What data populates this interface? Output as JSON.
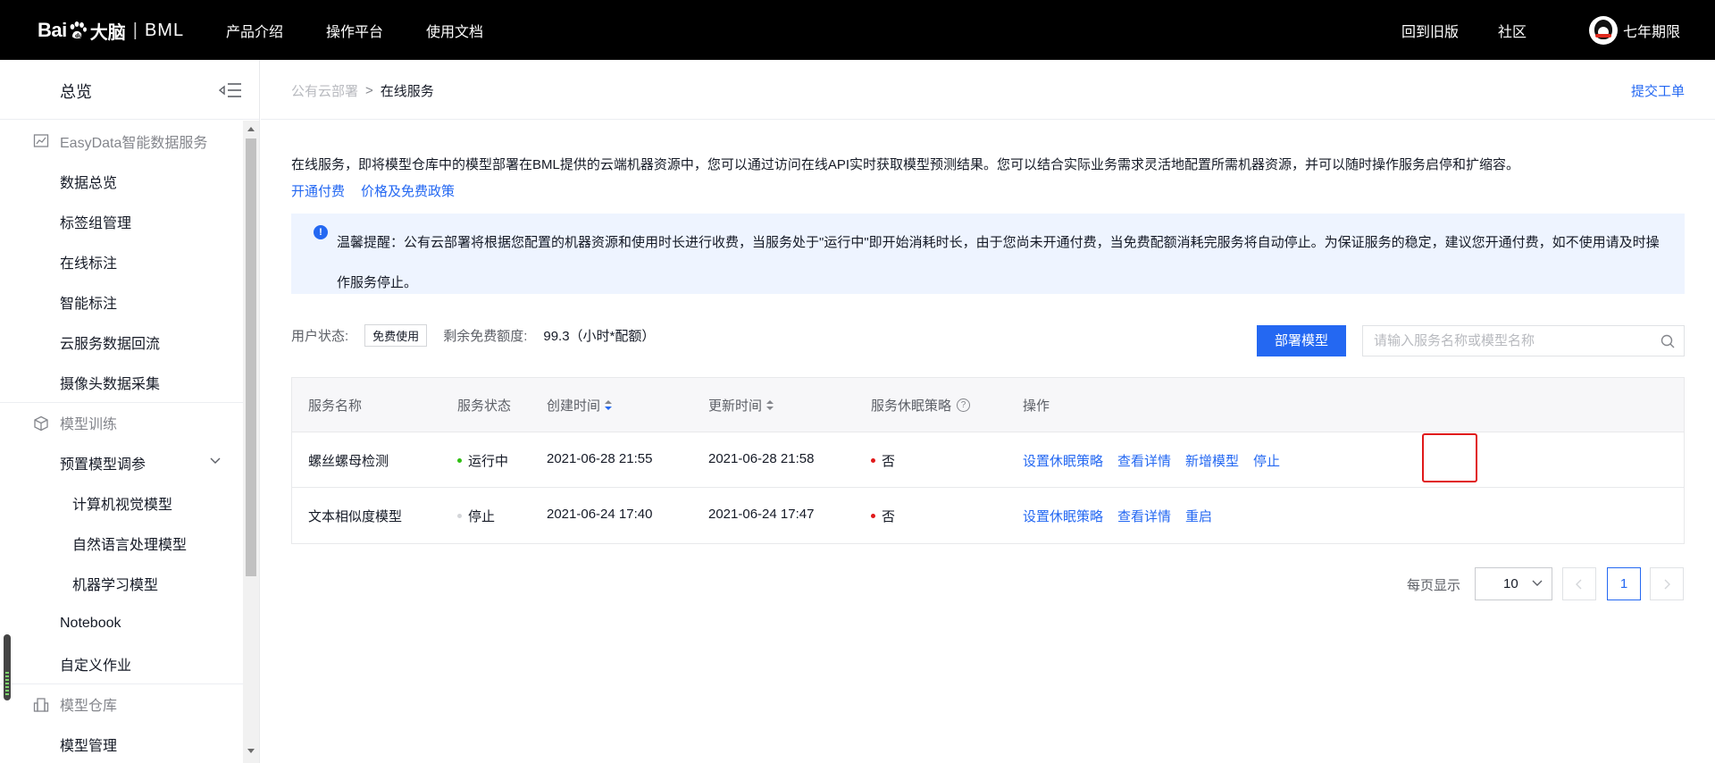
{
  "topbar": {
    "logo_bai": "Bai",
    "logo_du": "大脑",
    "logo_sep": "|",
    "logo_product": "BML",
    "nav": [
      "产品介绍",
      "操作平台",
      "使用文档"
    ],
    "right_links": [
      "回到旧版",
      "社区"
    ],
    "username": "七年期限"
  },
  "sidebar": {
    "title": "总览",
    "groups": [
      {
        "label": "EasyData智能数据服务",
        "icon": "chart-icon",
        "items": [
          "数据总览",
          "标签组管理",
          "在线标注",
          "智能标注",
          "云服务数据回流",
          "摄像头数据采集"
        ]
      },
      {
        "label": "模型训练",
        "icon": "cube-icon",
        "items": [
          "预置模型调参",
          "计算机视觉模型",
          "自然语言处理模型",
          "机器学习模型",
          "Notebook",
          "自定义作业"
        ]
      },
      {
        "label": "模型仓库",
        "icon": "building-icon",
        "items": [
          "模型管理"
        ]
      }
    ]
  },
  "breadcrumb": {
    "parent": "公有云部署",
    "separator": ">",
    "current": "在线服务"
  },
  "header_action": "提交工单",
  "description": "在线服务，即将模型仓库中的模型部署在BML提供的云端机器资源中，您可以通过访问在线API实时获取模型预测结果。您可以结合实际业务需求灵活地配置所需机器资源，并可以随时操作服务启停和扩缩容。",
  "desc_links": [
    "开通付费",
    "价格及免费政策"
  ],
  "notice": {
    "icon": "info-icon",
    "text": "温馨提醒：公有云部署将根据您配置的机器资源和使用时长进行收费，当服务处于\"运行中\"即开始消耗时长，由于您尚未开通付费，当免费配额消耗完服务将自动停止。为保证服务的稳定，建议您开通付费，如不使用请及时操作服务停止。"
  },
  "status": {
    "user_status_label": "用户状态:",
    "user_status_tag": "免费使用",
    "quota_label": "剩余免费额度:",
    "quota_value": "99.3（小时*配额）"
  },
  "deploy_button": "部署模型",
  "search": {
    "placeholder": "请输入服务名称或模型名称",
    "value": ""
  },
  "table": {
    "headers": [
      "服务名称",
      "服务状态",
      "创建时间",
      "更新时间",
      "服务休眠策略",
      "操作"
    ],
    "rows": [
      {
        "name": "螺丝螺母检测",
        "status": "运行中",
        "status_color": "#30bf13",
        "created": "2021-06-28 21:55",
        "updated": "2021-06-28 21:58",
        "sleep": "否",
        "actions": [
          "设置休眠策略",
          "查看详情",
          "新增模型",
          "停止"
        ]
      },
      {
        "name": "文本相似度模型",
        "status": "停止",
        "status_color": "#d4d6d9",
        "created": "2021-06-24 17:40",
        "updated": "2021-06-24 17:47",
        "sleep": "否",
        "actions": [
          "设置休眠策略",
          "查看详情",
          "重启"
        ]
      }
    ]
  },
  "pagination": {
    "per_page_label": "每页显示",
    "per_page": "10",
    "current_page": "1"
  },
  "colors": {
    "accent": "#2468f2",
    "highlight": "#e0191a",
    "sleep_dot": "#e0191a",
    "topbar": "#000000"
  }
}
